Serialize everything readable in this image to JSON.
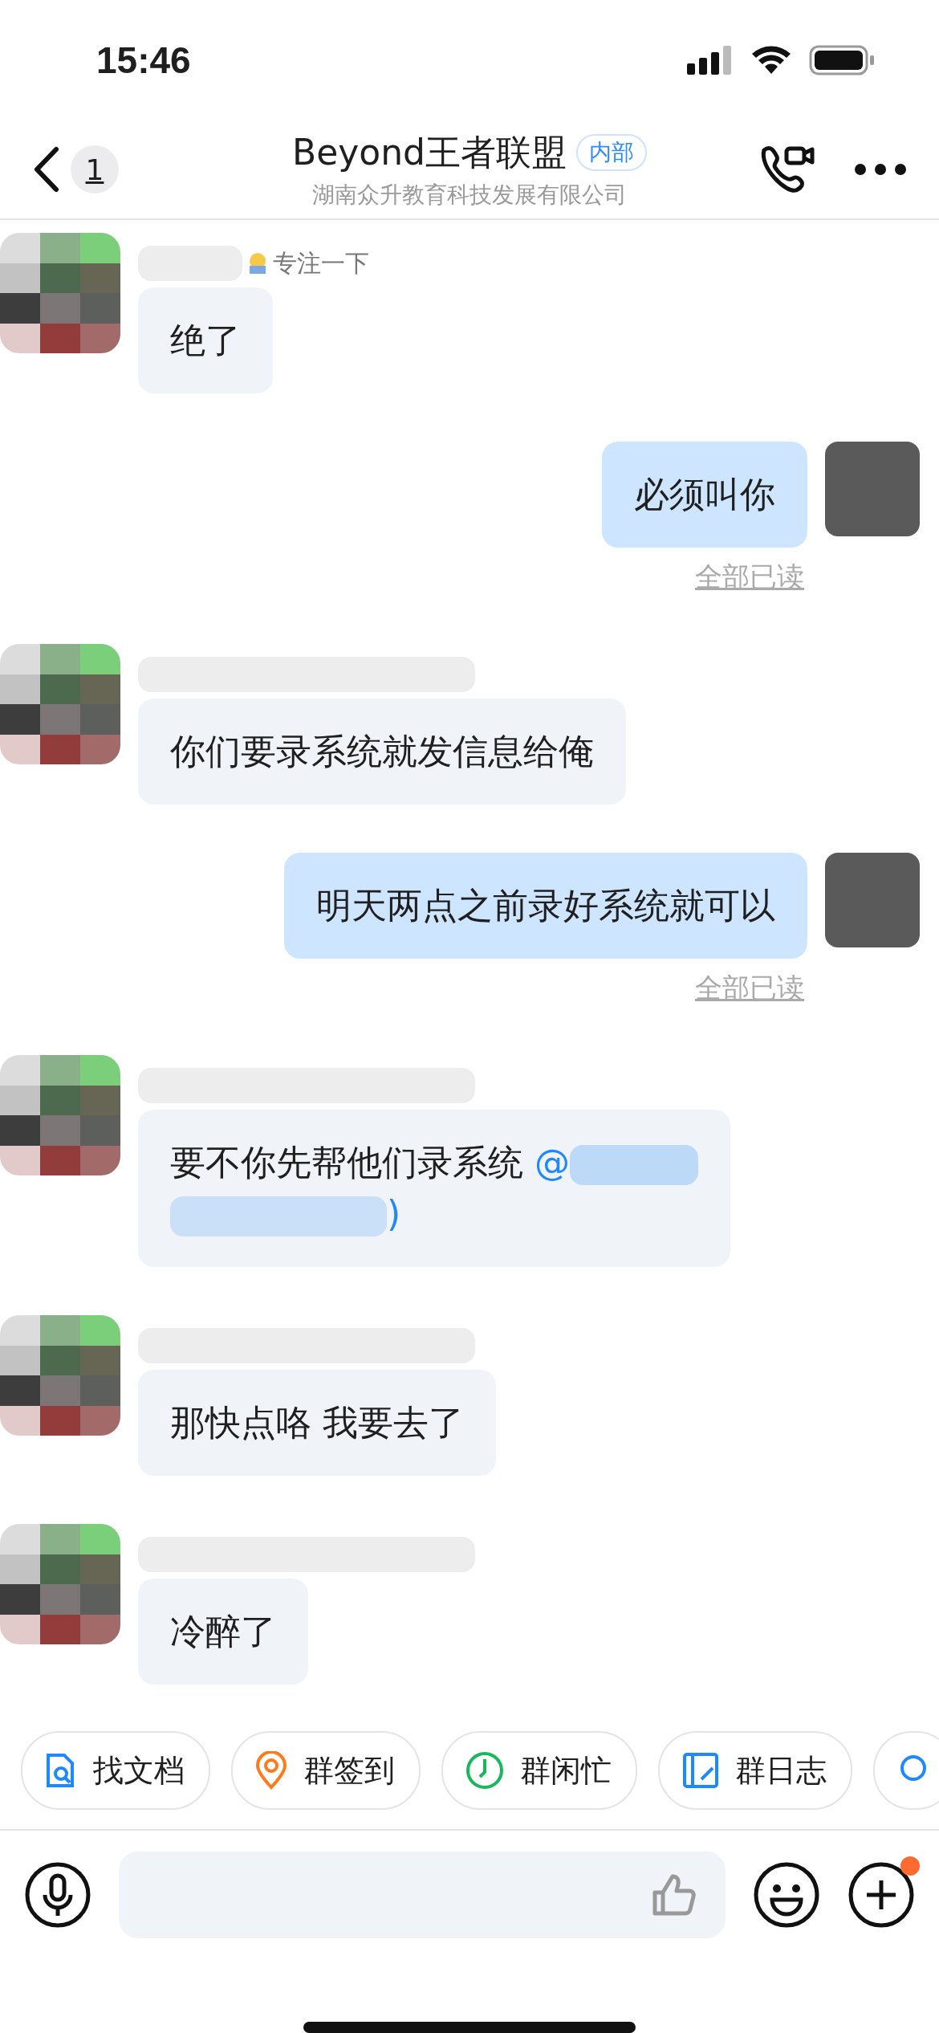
{
  "status_bar": {
    "time": "15:46"
  },
  "header": {
    "back_badge": "1",
    "title": "Beyond王者联盟",
    "tag": "内部",
    "subtitle": "湖南众升教育科技发展有限公司"
  },
  "messages": [
    {
      "kind": "received",
      "status": "专注一下",
      "text": "绝了"
    },
    {
      "kind": "sent",
      "text": "必须叫你",
      "receipt": "全部已读"
    },
    {
      "kind": "received",
      "text": "你们要录系统就发信息给俺"
    },
    {
      "kind": "sent",
      "text": "明天两点之前录好系统就可以",
      "receipt": "全部已读"
    },
    {
      "kind": "received",
      "text": "要不你先帮他们录系统",
      "mention": "@",
      "mention_tail": ")"
    },
    {
      "kind": "received",
      "text": "那快点咯 我要去了"
    },
    {
      "kind": "received",
      "text": "冷醉了"
    }
  ],
  "quick_actions": [
    {
      "kind": "doc",
      "label": "找文档"
    },
    {
      "kind": "checkin",
      "label": "群签到"
    },
    {
      "kind": "busy",
      "label": "群闲忙"
    },
    {
      "kind": "log",
      "label": "群日志"
    },
    {
      "kind": "more"
    }
  ],
  "composer": {
    "plus_badge": true
  }
}
